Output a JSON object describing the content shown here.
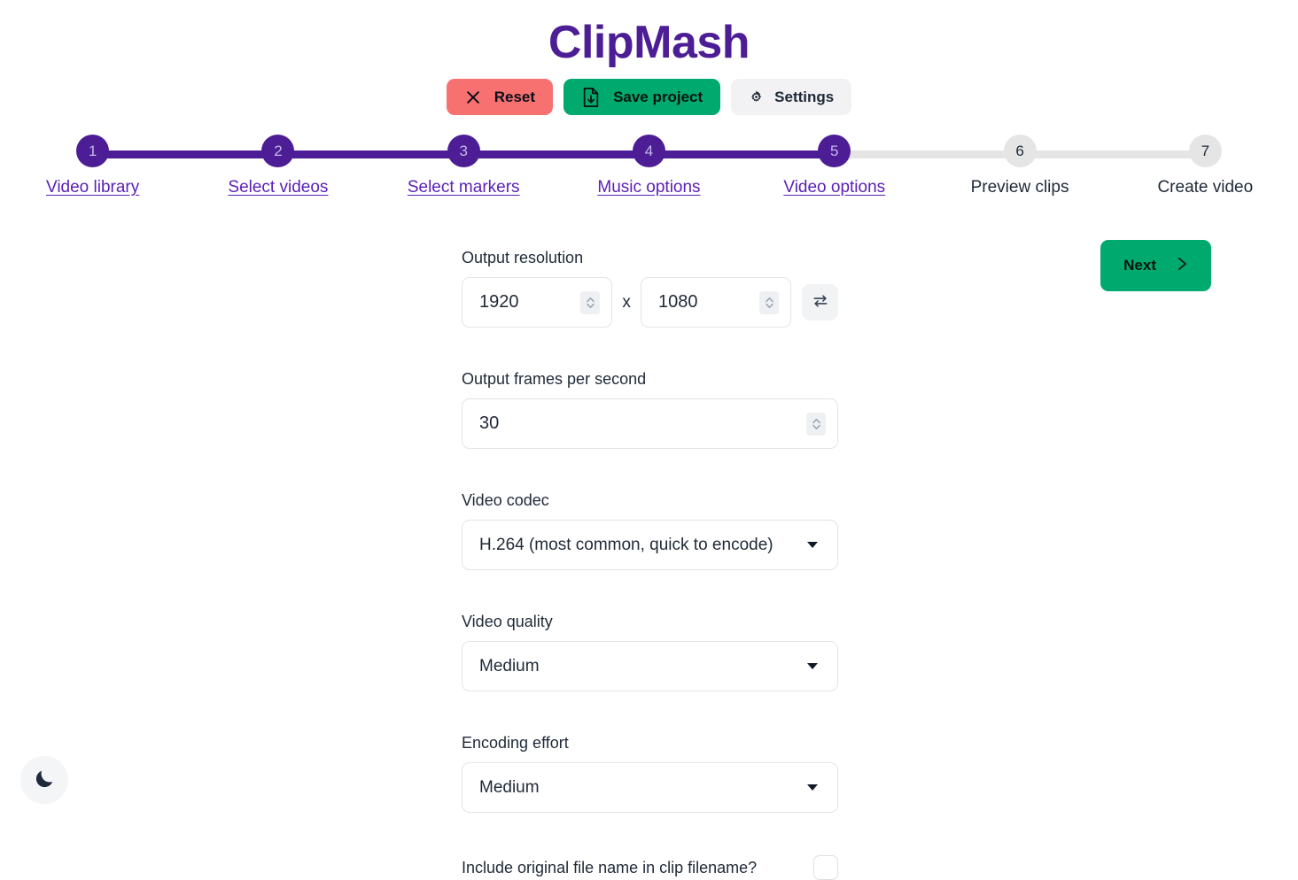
{
  "app": {
    "title": "ClipMash"
  },
  "toolbar": {
    "reset_label": "Reset",
    "save_label": "Save project",
    "settings_label": "Settings"
  },
  "stepper": {
    "steps": [
      {
        "number": "1",
        "label": "Video library",
        "state": "done"
      },
      {
        "number": "2",
        "label": "Select videos",
        "state": "done"
      },
      {
        "number": "3",
        "label": "Select markers",
        "state": "done"
      },
      {
        "number": "4",
        "label": "Music options",
        "state": "done"
      },
      {
        "number": "5",
        "label": "Video options",
        "state": "current"
      },
      {
        "number": "6",
        "label": "Preview clips",
        "state": "upcoming"
      },
      {
        "number": "7",
        "label": "Create video",
        "state": "upcoming"
      }
    ]
  },
  "next": {
    "label": "Next"
  },
  "form": {
    "resolution": {
      "label": "Output resolution",
      "width": "1920",
      "height": "1080",
      "separator": "x"
    },
    "fps": {
      "label": "Output frames per second",
      "value": "30"
    },
    "codec": {
      "label": "Video codec",
      "value": "H.264 (most common, quick to encode)"
    },
    "quality": {
      "label": "Video quality",
      "value": "Medium"
    },
    "effort": {
      "label": "Encoding effort",
      "value": "Medium"
    },
    "include_filename": {
      "label": "Include original file name in clip filename?",
      "checked": false
    }
  },
  "colors": {
    "brand_purple": "#4c1d95",
    "green": "#00a96e",
    "red": "#f87171",
    "gray": "#e5e5e6"
  }
}
